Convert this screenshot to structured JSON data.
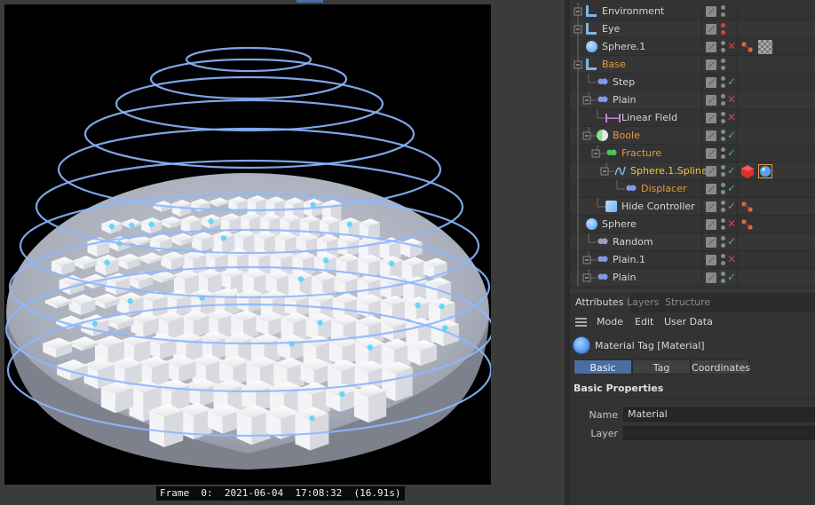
{
  "viewport": {
    "frame_label": "Frame  0:  2021-06-04  17:08:32  (16.91s)"
  },
  "object_manager": {
    "rows": [
      {
        "label": "Environment",
        "color": "normal",
        "icon": "environment-icon"
      },
      {
        "label": "Eye",
        "color": "normal",
        "icon": "camera-eye-icon"
      },
      {
        "label": "Sphere.1",
        "color": "normal",
        "icon": "sphere-icon"
      },
      {
        "label": "Base",
        "color": "orange",
        "icon": "null-object-icon"
      },
      {
        "label": "Step",
        "color": "normal",
        "icon": "step-effector-icon"
      },
      {
        "label": "Plain",
        "color": "normal",
        "icon": "plain-effector-icon"
      },
      {
        "label": "Linear Field",
        "color": "normal",
        "icon": "linear-field-icon"
      },
      {
        "label": "Boole",
        "color": "orange",
        "icon": "boole-icon"
      },
      {
        "label": "Fracture",
        "color": "orange",
        "icon": "fracture-icon"
      },
      {
        "label": "Sphere.1.Spline",
        "color": "yellow",
        "icon": "spline-icon"
      },
      {
        "label": "Displacer",
        "color": "orange",
        "icon": "displacer-icon"
      },
      {
        "label": "Hide Controller",
        "color": "normal",
        "icon": "cube-icon"
      },
      {
        "label": "Sphere",
        "color": "normal",
        "icon": "sphere-icon"
      },
      {
        "label": "Random",
        "color": "normal",
        "icon": "random-effector-icon"
      },
      {
        "label": "Plain.1",
        "color": "normal",
        "icon": "plain-effector-icon"
      },
      {
        "label": "Plain",
        "color": "normal",
        "icon": "plain-effector-icon"
      }
    ]
  },
  "attributes": {
    "tabs": [
      "Attributes",
      "Layers",
      "Structure"
    ],
    "menu": [
      "Mode",
      "Edit",
      "User Data"
    ],
    "header_title": "Material Tag [Material]",
    "mode_tabs": [
      "Basic",
      "Tag",
      "Coordinates"
    ],
    "section_title": "Basic Properties",
    "fields": [
      {
        "label": "Name",
        "value": "Material"
      },
      {
        "label": "Layer",
        "value": ""
      }
    ]
  },
  "colors": {
    "accent": "#4a6ea4",
    "orange_label": "#e8993d",
    "yellow_label": "#f3c546",
    "check": "#40c040",
    "cross": "#d04040",
    "wire_ring": "#8cb8ff"
  }
}
